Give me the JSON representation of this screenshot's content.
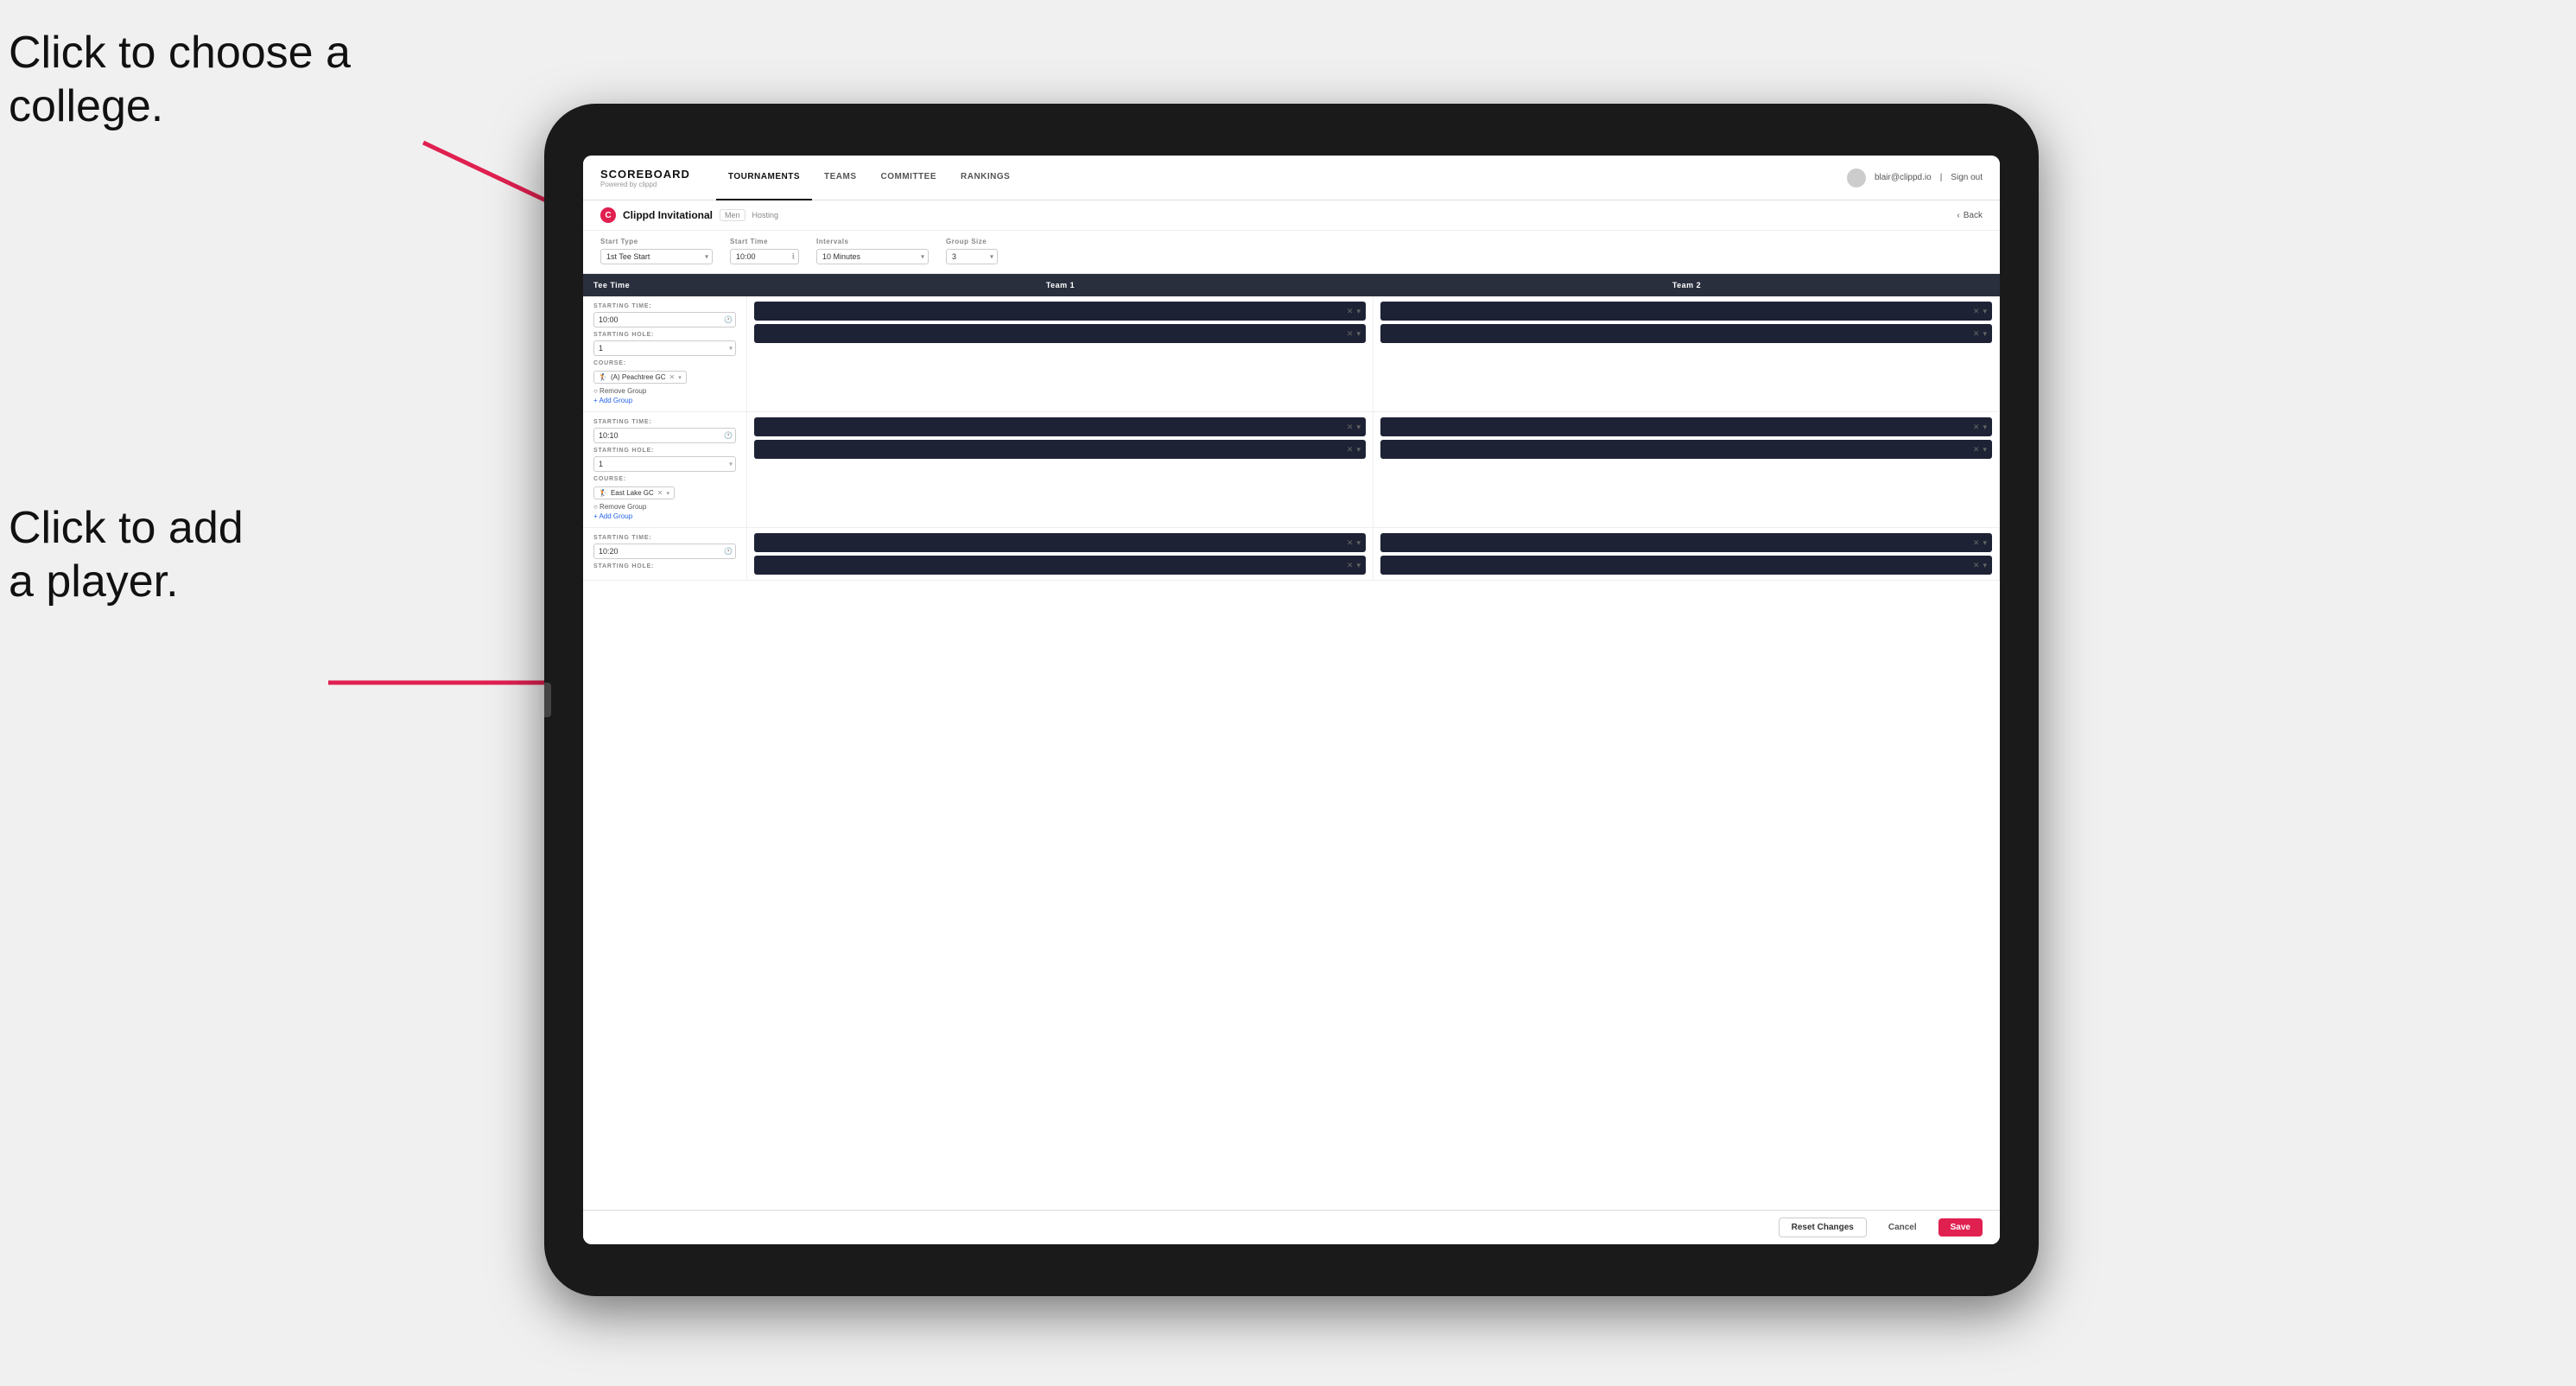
{
  "annotations": {
    "text1_line1": "Click to choose a",
    "text1_line2": "college.",
    "text2_line1": "Click to add",
    "text2_line2": "a player."
  },
  "navbar": {
    "brand": "SCOREBOARD",
    "brand_sub": "Powered by clippd",
    "links": [
      "TOURNAMENTS",
      "TEAMS",
      "COMMITTEE",
      "RANKINGS"
    ],
    "active_link": "TOURNAMENTS",
    "user_email": "blair@clippd.io",
    "sign_out": "Sign out"
  },
  "sub_header": {
    "title": "Clippd Invitational",
    "badge": "Men",
    "tag": "Hosting",
    "back": "Back"
  },
  "controls": {
    "start_type_label": "Start Type",
    "start_type_value": "1st Tee Start",
    "start_time_label": "Start Time",
    "start_time_value": "10:00",
    "intervals_label": "Intervals",
    "intervals_value": "10 Minutes",
    "group_size_label": "Group Size",
    "group_size_value": "3"
  },
  "table": {
    "col1": "Tee Time",
    "col2": "Team 1",
    "col3": "Team 2"
  },
  "groups": [
    {
      "id": 1,
      "starting_time": "10:00",
      "starting_hole": "1",
      "course": "(A) Peachtree GC",
      "team1_players": 2,
      "team2_players": 2,
      "actions": [
        "Remove Group",
        "Add Group"
      ]
    },
    {
      "id": 2,
      "starting_time": "10:10",
      "starting_hole": "1",
      "course": "East Lake GC",
      "team1_players": 2,
      "team2_players": 2,
      "actions": [
        "Remove Group",
        "Add Group"
      ]
    },
    {
      "id": 3,
      "starting_time": "10:20",
      "starting_hole": "",
      "course": "",
      "team1_players": 2,
      "team2_players": 2,
      "actions": []
    }
  ],
  "footer": {
    "reset": "Reset Changes",
    "cancel": "Cancel",
    "save": "Save"
  }
}
